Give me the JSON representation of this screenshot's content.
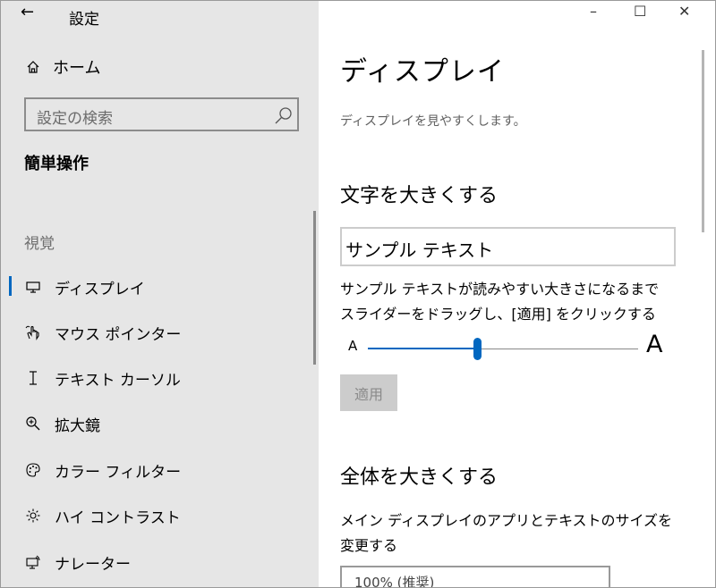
{
  "window": {
    "title": "設定",
    "back_glyph": "←",
    "minimize_glyph": "–",
    "maximize_glyph": "☐",
    "close_glyph": "✕"
  },
  "sidebar": {
    "home_label": "ホーム",
    "search_placeholder": "設定の検索",
    "category": "簡単操作",
    "section": "視覚",
    "items": [
      {
        "label": "ディスプレイ",
        "icon": "monitor-icon",
        "selected": true
      },
      {
        "label": "マウス ポインター",
        "icon": "pointer-hand-icon"
      },
      {
        "label": "テキスト カーソル",
        "icon": "text-cursor-icon"
      },
      {
        "label": "拡大鏡",
        "icon": "magnifier-icon"
      },
      {
        "label": "カラー フィルター",
        "icon": "palette-icon"
      },
      {
        "label": "ハイ コントラスト",
        "icon": "brightness-icon"
      },
      {
        "label": "ナレーター",
        "icon": "narrator-icon"
      }
    ]
  },
  "main": {
    "title": "ディスプレイ",
    "description": "ディスプレイを見やすくします。",
    "text_size": {
      "heading": "文字を大きくする",
      "sample": "サンプル テキスト",
      "instruction_line1": "サンプル テキストが読みやすい大きさになるまで",
      "instruction_line2": "スライダーをドラッグし、[適用] をクリックする",
      "slider_min_label": "A",
      "slider_max_label": "A",
      "apply_label": "適用"
    },
    "scale": {
      "heading": "全体を大きくする",
      "instruction_line1": "メイン ディスプレイのアプリとテキストのサイズを",
      "instruction_line2": "変更する",
      "dropdown_value": "100% (推奨)"
    }
  },
  "colors": {
    "accent": "#0067c0",
    "sidebar_bg": "#e6e6e6",
    "main_bg": "#ffffff"
  }
}
